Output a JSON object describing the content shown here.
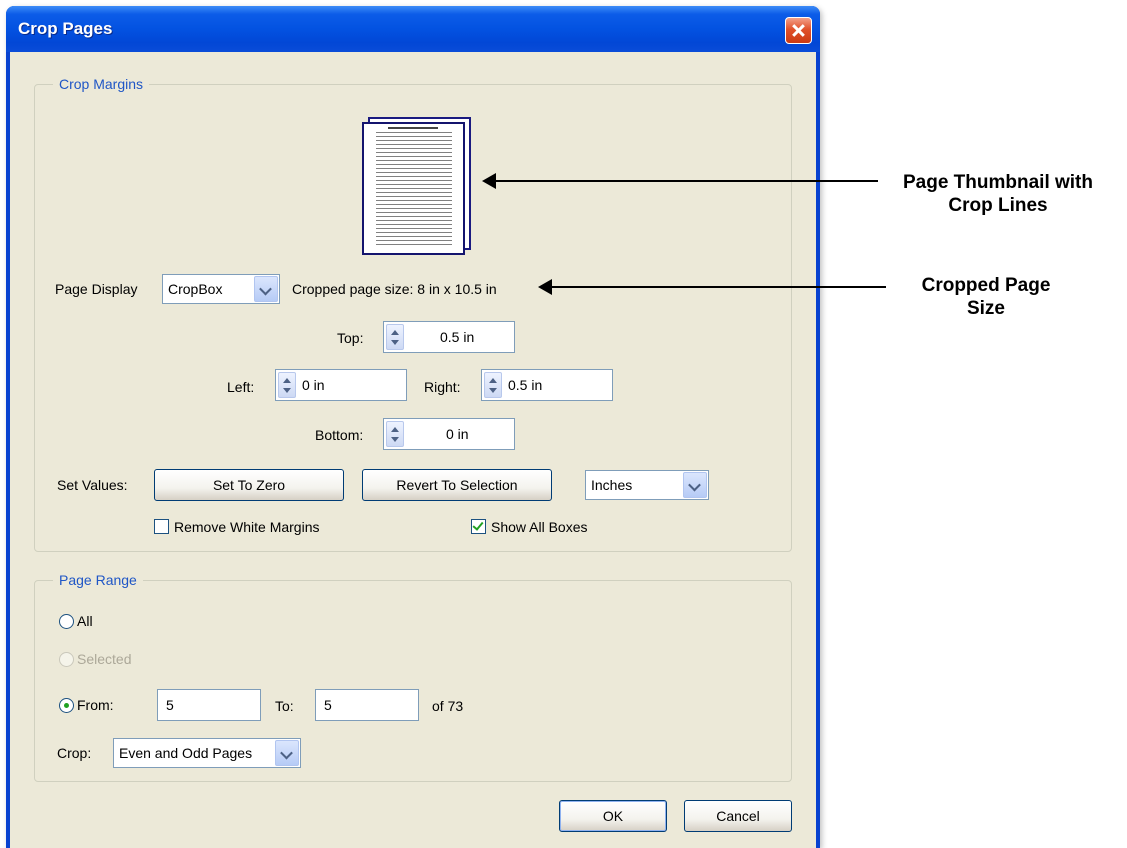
{
  "dialog": {
    "title": "Crop Pages"
  },
  "crop_margins": {
    "legend": "Crop Margins",
    "page_display_label": "Page Display",
    "page_display_value": "CropBox",
    "cropped_size_text": "Cropped page size: 8 in x 10.5 in",
    "top_label": "Top:",
    "top_value": "0.5 in",
    "left_label": "Left:",
    "left_value": "0 in",
    "right_label": "Right:",
    "right_value": "0.5 in",
    "bottom_label": "Bottom:",
    "bottom_value": "0 in",
    "set_values_label": "Set Values:",
    "set_to_zero": "Set To Zero",
    "revert_to_selection": "Revert To Selection",
    "units_value": "Inches",
    "remove_white_margins": "Remove White Margins",
    "remove_white_margins_checked": false,
    "show_all_boxes": "Show All Boxes",
    "show_all_boxes_checked": true
  },
  "page_range": {
    "legend": "Page Range",
    "all_label": "All",
    "selected_label": "Selected",
    "from_label": "From:",
    "from_value": "5",
    "to_label": "To:",
    "to_value": "5",
    "of_text": "of 73",
    "crop_label": "Crop:",
    "crop_value": "Even and Odd Pages",
    "selected_option": "From"
  },
  "footer": {
    "ok": "OK",
    "cancel": "Cancel"
  },
  "annotations": {
    "thumbnail_line1": "Page Thumbnail with",
    "thumbnail_line2": "Crop Lines",
    "cropped_line1": "Cropped Page",
    "cropped_line2": "Size"
  },
  "colors": {
    "title_bar": "#0352e1",
    "dialog_bg": "#ece9d8",
    "legend_text": "#1f56c6",
    "close_button": "#e0512b"
  },
  "icons": {
    "close": "close-x-icon",
    "spin": "spin-up-down-icon",
    "dropdown": "chevron-down-icon"
  }
}
